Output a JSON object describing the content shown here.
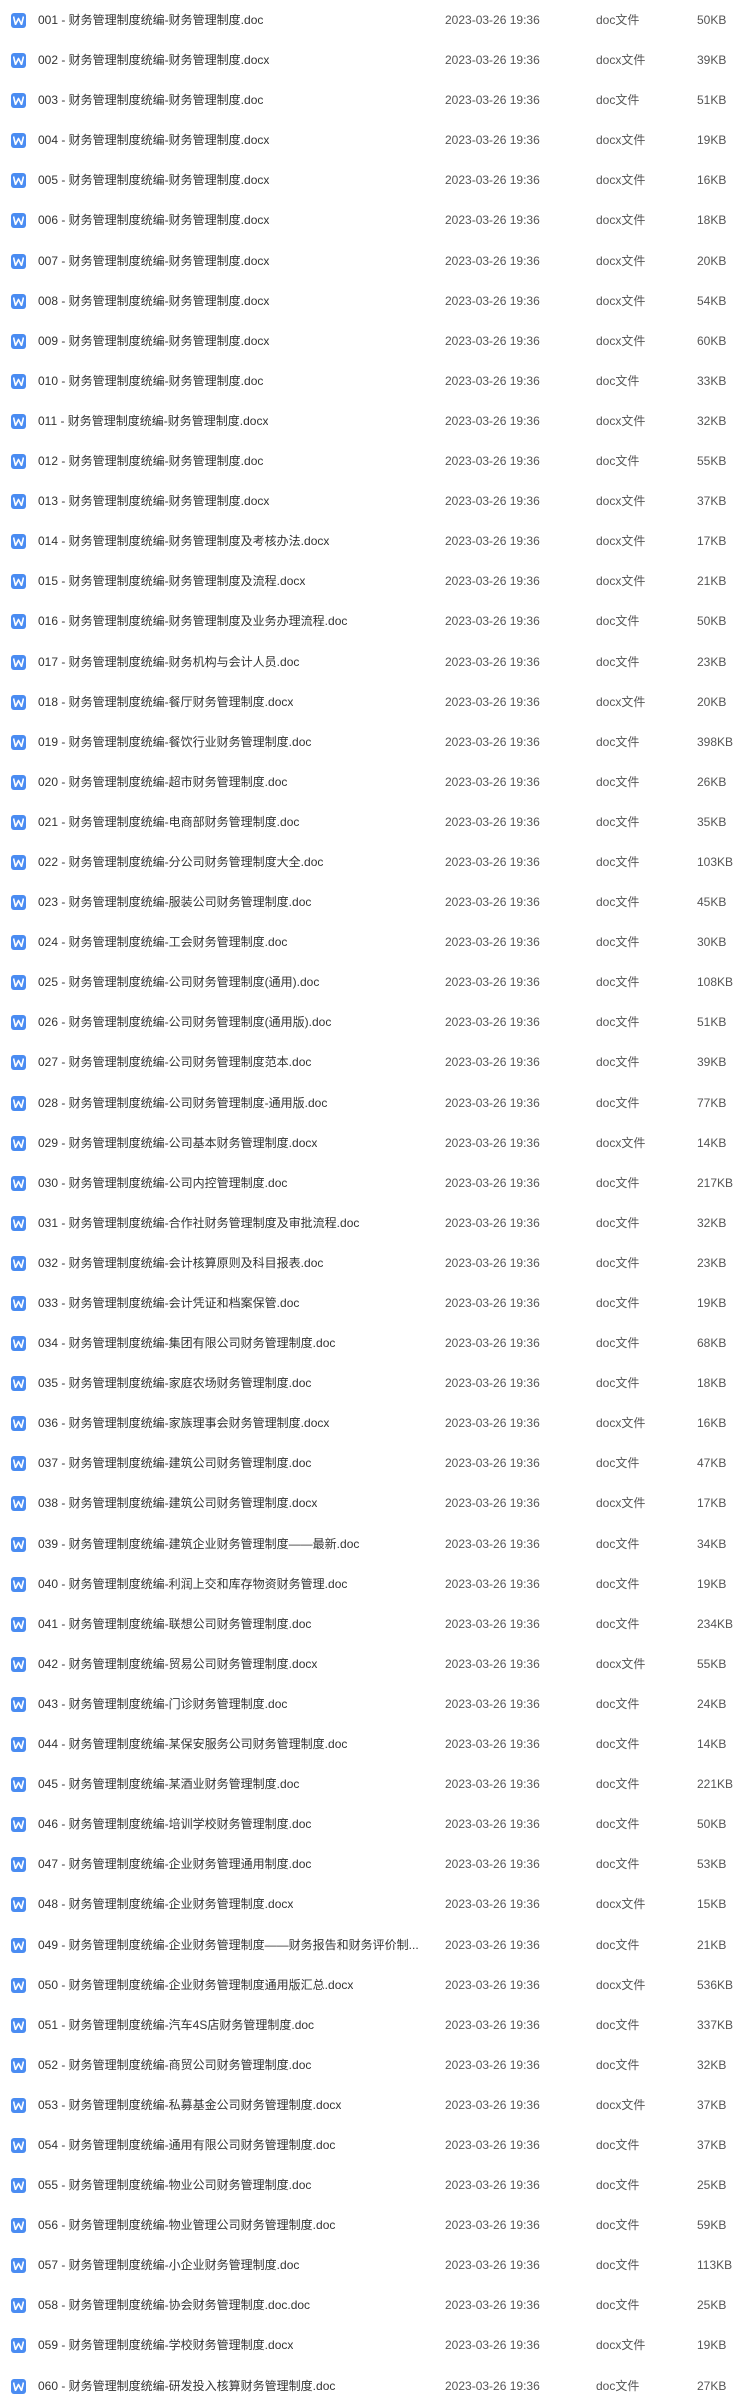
{
  "icon": {
    "name": "word-doc-icon",
    "color": "#4a8cf2"
  },
  "files": [
    {
      "name": "001 - 财务管理制度统编-财务管理制度.doc",
      "modified": "2023-03-26 19:36",
      "type": "doc文件",
      "size": "50KB"
    },
    {
      "name": "002 - 财务管理制度统编-财务管理制度.docx",
      "modified": "2023-03-26 19:36",
      "type": "docx文件",
      "size": "39KB"
    },
    {
      "name": "003 - 财务管理制度统编-财务管理制度.doc",
      "modified": "2023-03-26 19:36",
      "type": "doc文件",
      "size": "51KB"
    },
    {
      "name": "004 - 财务管理制度统编-财务管理制度.docx",
      "modified": "2023-03-26 19:36",
      "type": "docx文件",
      "size": "19KB"
    },
    {
      "name": "005 - 财务管理制度统编-财务管理制度.docx",
      "modified": "2023-03-26 19:36",
      "type": "docx文件",
      "size": "16KB"
    },
    {
      "name": "006 - 财务管理制度统编-财务管理制度.docx",
      "modified": "2023-03-26 19:36",
      "type": "docx文件",
      "size": "18KB"
    },
    {
      "name": "007 - 财务管理制度统编-财务管理制度.docx",
      "modified": "2023-03-26 19:36",
      "type": "docx文件",
      "size": "20KB"
    },
    {
      "name": "008 - 财务管理制度统编-财务管理制度.docx",
      "modified": "2023-03-26 19:36",
      "type": "docx文件",
      "size": "54KB"
    },
    {
      "name": "009 - 财务管理制度统编-财务管理制度.docx",
      "modified": "2023-03-26 19:36",
      "type": "docx文件",
      "size": "60KB"
    },
    {
      "name": "010 - 财务管理制度统编-财务管理制度.doc",
      "modified": "2023-03-26 19:36",
      "type": "doc文件",
      "size": "33KB"
    },
    {
      "name": "011 - 财务管理制度统编-财务管理制度.docx",
      "modified": "2023-03-26 19:36",
      "type": "docx文件",
      "size": "32KB"
    },
    {
      "name": "012 - 财务管理制度统编-财务管理制度.doc",
      "modified": "2023-03-26 19:36",
      "type": "doc文件",
      "size": "55KB"
    },
    {
      "name": "013 - 财务管理制度统编-财务管理制度.docx",
      "modified": "2023-03-26 19:36",
      "type": "docx文件",
      "size": "37KB"
    },
    {
      "name": "014 - 财务管理制度统编-财务管理制度及考核办法.docx",
      "modified": "2023-03-26 19:36",
      "type": "docx文件",
      "size": "17KB"
    },
    {
      "name": "015 - 财务管理制度统编-财务管理制度及流程.docx",
      "modified": "2023-03-26 19:36",
      "type": "docx文件",
      "size": "21KB"
    },
    {
      "name": "016 - 财务管理制度统编-财务管理制度及业务办理流程.doc",
      "modified": "2023-03-26 19:36",
      "type": "doc文件",
      "size": "50KB"
    },
    {
      "name": "017 - 财务管理制度统编-财务机构与会计人员.doc",
      "modified": "2023-03-26 19:36",
      "type": "doc文件",
      "size": "23KB"
    },
    {
      "name": "018 - 财务管理制度统编-餐厅财务管理制度.docx",
      "modified": "2023-03-26 19:36",
      "type": "docx文件",
      "size": "20KB"
    },
    {
      "name": "019 - 财务管理制度统编-餐饮行业财务管理制度.doc",
      "modified": "2023-03-26 19:36",
      "type": "doc文件",
      "size": "398KB"
    },
    {
      "name": "020 - 财务管理制度统编-超市财务管理制度.doc",
      "modified": "2023-03-26 19:36",
      "type": "doc文件",
      "size": "26KB"
    },
    {
      "name": "021 - 财务管理制度统编-电商部财务管理制度.doc",
      "modified": "2023-03-26 19:36",
      "type": "doc文件",
      "size": "35KB"
    },
    {
      "name": "022 - 财务管理制度统编-分公司财务管理制度大全.doc",
      "modified": "2023-03-26 19:36",
      "type": "doc文件",
      "size": "103KB"
    },
    {
      "name": "023 - 财务管理制度统编-服装公司财务管理制度.doc",
      "modified": "2023-03-26 19:36",
      "type": "doc文件",
      "size": "45KB"
    },
    {
      "name": "024 - 财务管理制度统编-工会财务管理制度.doc",
      "modified": "2023-03-26 19:36",
      "type": "doc文件",
      "size": "30KB"
    },
    {
      "name": "025 - 财务管理制度统编-公司财务管理制度(通用).doc",
      "modified": "2023-03-26 19:36",
      "type": "doc文件",
      "size": "108KB"
    },
    {
      "name": "026 - 财务管理制度统编-公司财务管理制度(通用版).doc",
      "modified": "2023-03-26 19:36",
      "type": "doc文件",
      "size": "51KB"
    },
    {
      "name": "027 - 财务管理制度统编-公司财务管理制度范本.doc",
      "modified": "2023-03-26 19:36",
      "type": "doc文件",
      "size": "39KB"
    },
    {
      "name": "028 - 财务管理制度统编-公司财务管理制度-通用版.doc",
      "modified": "2023-03-26 19:36",
      "type": "doc文件",
      "size": "77KB"
    },
    {
      "name": "029 - 财务管理制度统编-公司基本财务管理制度.docx",
      "modified": "2023-03-26 19:36",
      "type": "docx文件",
      "size": "14KB"
    },
    {
      "name": "030 - 财务管理制度统编-公司内控管理制度.doc",
      "modified": "2023-03-26 19:36",
      "type": "doc文件",
      "size": "217KB"
    },
    {
      "name": "031 - 财务管理制度统编-合作社财务管理制度及审批流程.doc",
      "modified": "2023-03-26 19:36",
      "type": "doc文件",
      "size": "32KB"
    },
    {
      "name": "032 - 财务管理制度统编-会计核算原则及科目报表.doc",
      "modified": "2023-03-26 19:36",
      "type": "doc文件",
      "size": "23KB"
    },
    {
      "name": "033 - 财务管理制度统编-会计凭证和档案保管.doc",
      "modified": "2023-03-26 19:36",
      "type": "doc文件",
      "size": "19KB"
    },
    {
      "name": "034 - 财务管理制度统编-集团有限公司财务管理制度.doc",
      "modified": "2023-03-26 19:36",
      "type": "doc文件",
      "size": "68KB"
    },
    {
      "name": "035 - 财务管理制度统编-家庭农场财务管理制度.doc",
      "modified": "2023-03-26 19:36",
      "type": "doc文件",
      "size": "18KB"
    },
    {
      "name": "036 - 财务管理制度统编-家族理事会财务管理制度.docx",
      "modified": "2023-03-26 19:36",
      "type": "docx文件",
      "size": "16KB"
    },
    {
      "name": "037 - 财务管理制度统编-建筑公司财务管理制度.doc",
      "modified": "2023-03-26 19:36",
      "type": "doc文件",
      "size": "47KB"
    },
    {
      "name": "038 - 财务管理制度统编-建筑公司财务管理制度.docx",
      "modified": "2023-03-26 19:36",
      "type": "docx文件",
      "size": "17KB"
    },
    {
      "name": "039 - 财务管理制度统编-建筑企业财务管理制度——最新.doc",
      "modified": "2023-03-26 19:36",
      "type": "doc文件",
      "size": "34KB"
    },
    {
      "name": "040 - 财务管理制度统编-利润上交和库存物资财务管理.doc",
      "modified": "2023-03-26 19:36",
      "type": "doc文件",
      "size": "19KB"
    },
    {
      "name": "041 - 财务管理制度统编-联想公司财务管理制度.doc",
      "modified": "2023-03-26 19:36",
      "type": "doc文件",
      "size": "234KB"
    },
    {
      "name": "042 - 财务管理制度统编-贸易公司财务管理制度.docx",
      "modified": "2023-03-26 19:36",
      "type": "docx文件",
      "size": "55KB"
    },
    {
      "name": "043 - 财务管理制度统编-门诊财务管理制度.doc",
      "modified": "2023-03-26 19:36",
      "type": "doc文件",
      "size": "24KB"
    },
    {
      "name": "044 - 财务管理制度统编-某保安服务公司财务管理制度.doc",
      "modified": "2023-03-26 19:36",
      "type": "doc文件",
      "size": "14KB"
    },
    {
      "name": "045 - 财务管理制度统编-某酒业财务管理制度.doc",
      "modified": "2023-03-26 19:36",
      "type": "doc文件",
      "size": "221KB"
    },
    {
      "name": "046 - 财务管理制度统编-培训学校财务管理制度.doc",
      "modified": "2023-03-26 19:36",
      "type": "doc文件",
      "size": "50KB"
    },
    {
      "name": "047 - 财务管理制度统编-企业财务管理通用制度.doc",
      "modified": "2023-03-26 19:36",
      "type": "doc文件",
      "size": "53KB"
    },
    {
      "name": "048 - 财务管理制度统编-企业财务管理制度.docx",
      "modified": "2023-03-26 19:36",
      "type": "docx文件",
      "size": "15KB"
    },
    {
      "name": "049 - 财务管理制度统编-企业财务管理制度——财务报告和财务评价制...",
      "modified": "2023-03-26 19:36",
      "type": "doc文件",
      "size": "21KB"
    },
    {
      "name": "050 - 财务管理制度统编-企业财务管理制度通用版汇总.docx",
      "modified": "2023-03-26 19:36",
      "type": "docx文件",
      "size": "536KB"
    },
    {
      "name": "051 - 财务管理制度统编-汽车4S店财务管理制度.doc",
      "modified": "2023-03-26 19:36",
      "type": "doc文件",
      "size": "337KB"
    },
    {
      "name": "052 - 财务管理制度统编-商贸公司财务管理制度.doc",
      "modified": "2023-03-26 19:36",
      "type": "doc文件",
      "size": "32KB"
    },
    {
      "name": "053 - 财务管理制度统编-私募基金公司财务管理制度.docx",
      "modified": "2023-03-26 19:36",
      "type": "docx文件",
      "size": "37KB"
    },
    {
      "name": "054 - 财务管理制度统编-通用有限公司财务管理制度.doc",
      "modified": "2023-03-26 19:36",
      "type": "doc文件",
      "size": "37KB"
    },
    {
      "name": "055 - 财务管理制度统编-物业公司财务管理制度.doc",
      "modified": "2023-03-26 19:36",
      "type": "doc文件",
      "size": "25KB"
    },
    {
      "name": "056 - 财务管理制度统编-物业管理公司财务管理制度.doc",
      "modified": "2023-03-26 19:36",
      "type": "doc文件",
      "size": "59KB"
    },
    {
      "name": "057 - 财务管理制度统编-小企业财务管理制度.doc",
      "modified": "2023-03-26 19:36",
      "type": "doc文件",
      "size": "113KB"
    },
    {
      "name": "058 - 财务管理制度统编-协会财务管理制度.doc.doc",
      "modified": "2023-03-26 19:36",
      "type": "doc文件",
      "size": "25KB"
    },
    {
      "name": "059 - 财务管理制度统编-学校财务管理制度.docx",
      "modified": "2023-03-26 19:36",
      "type": "docx文件",
      "size": "19KB"
    },
    {
      "name": "060 - 财务管理制度统编-研发投入核算财务管理制度.doc",
      "modified": "2023-03-26 19:36",
      "type": "doc文件",
      "size": "27KB"
    }
  ]
}
